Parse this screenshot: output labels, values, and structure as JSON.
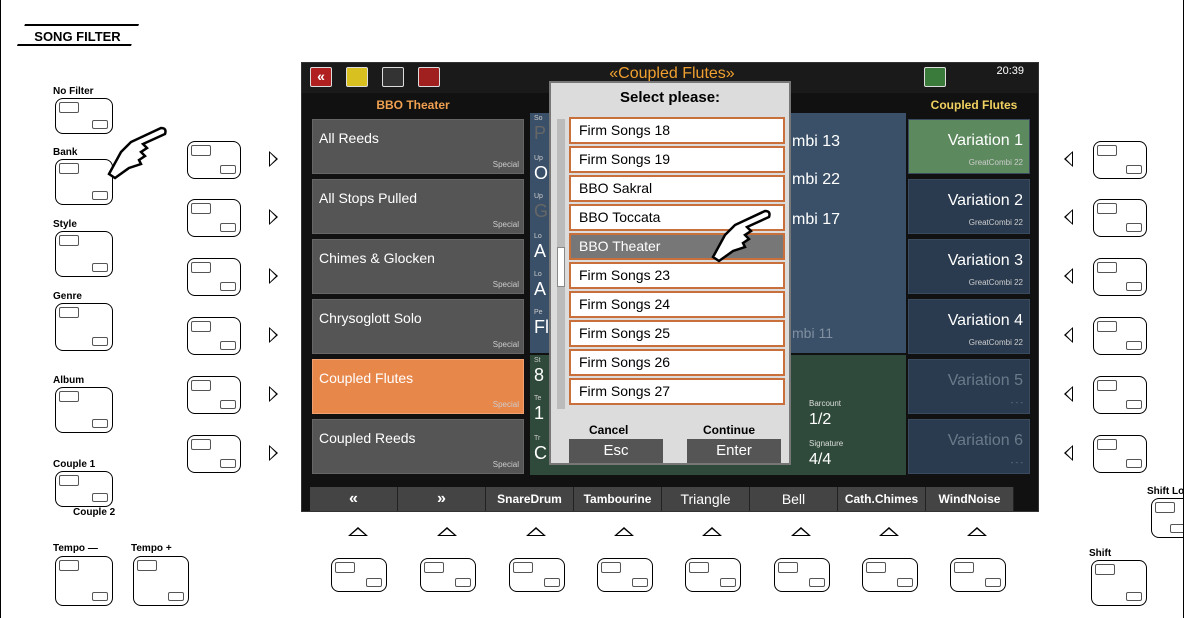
{
  "panel": {
    "title": "SONG FILTER"
  },
  "left_labels": {
    "no_filter": "No Filter",
    "bank": "Bank",
    "style": "Style",
    "genre": "Genre",
    "album": "Album",
    "couple1": "Couple 1",
    "couple2": "Couple 2",
    "tempo_minus": "Tempo —",
    "tempo_plus": "Tempo +"
  },
  "right_labels": {
    "shift_lock": "Shift Lo",
    "shift": "Shift"
  },
  "screen": {
    "title": "«Coupled Flutes»",
    "time": "20:39",
    "left_header": "BBO Theater",
    "right_header": "Coupled Flutes",
    "list": [
      {
        "name": "All Reeds",
        "tag": "Special"
      },
      {
        "name": "All Stops Pulled",
        "tag": "Special"
      },
      {
        "name": "Chimes & Glocken",
        "tag": "Special"
      },
      {
        "name": "Chrysoglott Solo",
        "tag": "Special"
      },
      {
        "name": "Coupled Flutes",
        "tag": "Special"
      },
      {
        "name": "Coupled Reeds",
        "tag": "Special"
      }
    ],
    "variations": [
      {
        "name": "Variation 1",
        "tag": "GreatCombi  22"
      },
      {
        "name": "Variation 2",
        "tag": "GreatCombi  22"
      },
      {
        "name": "Variation 3",
        "tag": "GreatCombi  22"
      },
      {
        "name": "Variation 4",
        "tag": "GreatCombi  22"
      },
      {
        "name": "Variation 5",
        "tag": "- - -"
      },
      {
        "name": "Variation 6",
        "tag": "- - -"
      }
    ],
    "combi": [
      "mbi 13",
      "mbi 22",
      "mbi 17",
      "mbi 11"
    ],
    "status": {
      "barcount_label": "Barcount",
      "barcount": "1/2",
      "signature_label": "Signature",
      "signature": "4/4"
    },
    "mid_frag": [
      "So",
      "P",
      "Up",
      "O",
      "Up",
      "G",
      "Lo",
      "A",
      "Lo",
      "A",
      "Pe",
      "Fl",
      "St",
      "8",
      "Te",
      "1",
      "Tr",
      "C"
    ],
    "bottom": [
      "«",
      "»",
      "SnareDrum",
      "Tambourine",
      "Triangle",
      "Bell",
      "Cath.Chimes",
      "WindNoise"
    ]
  },
  "dialog": {
    "title": "Select please:",
    "items": [
      "Firm Songs 18",
      "Firm Songs 19",
      "BBO Sakral",
      "BBO Toccata",
      "BBO Theater",
      "Firm Songs 23",
      "Firm Songs 24",
      "Firm Songs 25",
      "Firm Songs 26",
      "Firm Songs 27"
    ],
    "cancel_label": "Cancel",
    "cancel_key": "Esc",
    "continue_label": "Continue",
    "continue_key": "Enter"
  }
}
